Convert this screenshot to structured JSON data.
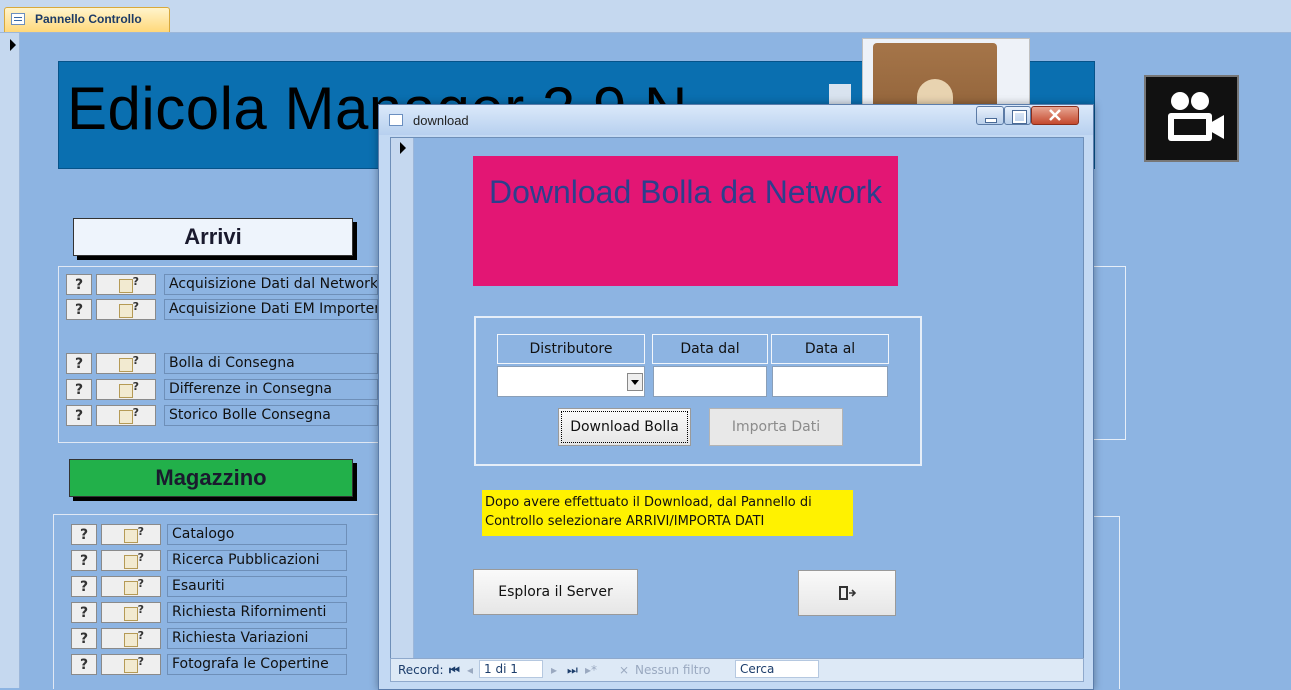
{
  "tab": {
    "label": "Pannello Controllo"
  },
  "banner": {
    "title": "Edicola Manager 2.9 N"
  },
  "sections": {
    "arrivi": {
      "label": "Arrivi",
      "items": [
        "Acquisizione Dati dal Network",
        "Acquisizione Dati EM Importer",
        "Bolla di Consegna",
        "Differenze in Consegna",
        "Storico Bolle Consegna"
      ]
    },
    "magazzino": {
      "label": "Magazzino",
      "items": [
        "Catalogo",
        "Ricerca Pubblicazioni",
        "Esauriti",
        "Richiesta Rifornimenti",
        "Richiesta Variazioni",
        "Fotografa le Copertine"
      ]
    }
  },
  "row_button_text": "?",
  "dialog": {
    "title": "download",
    "heading": "Download Bolla da Network",
    "columns": [
      "Distributore",
      "Data dal",
      "Data al"
    ],
    "download_button": "Download Bolla",
    "import_button": "Importa Dati",
    "note": "Dopo avere effettuato il Download, dal Pannello di Controllo selezionare ARRIVI/IMPORTA DATI",
    "explore_button": "Esplora il Server",
    "exit_icon": "exit-door-icon"
  },
  "statusbar": {
    "record_label": "Record:",
    "position": "1 di 1",
    "filter": "Nessun filtro",
    "search": "Cerca"
  },
  "colors": {
    "background": "#8db4e2",
    "banner": "#0a6fb0",
    "heading_block": "#e31674",
    "note": "#fff200",
    "arrivi": "#eef4fc",
    "magazzino": "#22b04a"
  }
}
